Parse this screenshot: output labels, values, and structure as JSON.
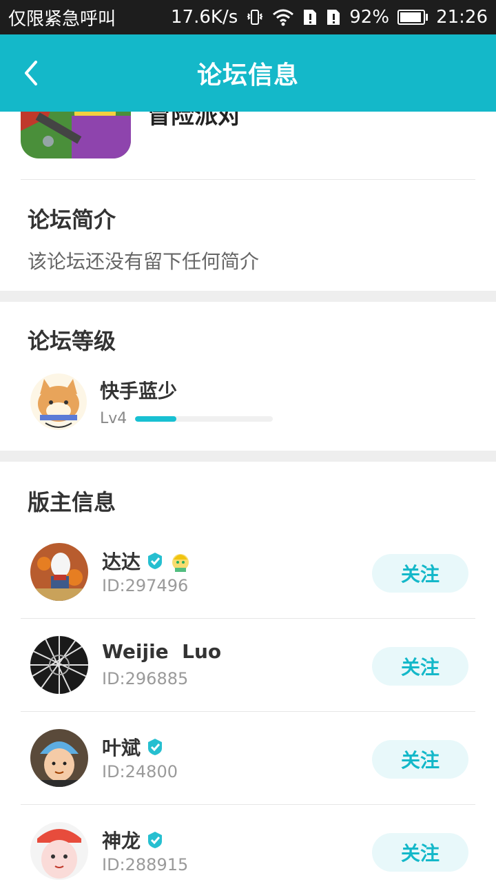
{
  "status_bar": {
    "carrier": "仅限紧急呼叫",
    "speed": "17.6K/s",
    "battery_percent": "92%",
    "battery_level": 0.92,
    "time": "21:26"
  },
  "header": {
    "title": "论坛信息"
  },
  "forum": {
    "name_partial": "冒险派对"
  },
  "intro": {
    "title": "论坛简介",
    "text": "该论坛还没有留下任何简介"
  },
  "level": {
    "title": "论坛等级",
    "user_name": "快手蓝少",
    "level_label": "Lv4",
    "progress_fraction": 0.3
  },
  "moderators": {
    "title": "版主信息",
    "follow_label": "关注",
    "items": [
      {
        "name": "达达",
        "id": "ID:297496",
        "verified": true
      },
      {
        "name": "Weijie  Luo",
        "id": "ID:296885",
        "verified": false
      },
      {
        "name": "叶斌",
        "id": "ID:24800",
        "verified": true
      },
      {
        "name": "神龙",
        "id": "ID:288915",
        "verified": true
      }
    ]
  },
  "colors": {
    "accent": "#14b8c9",
    "follow_bg": "#e8f8fa"
  }
}
